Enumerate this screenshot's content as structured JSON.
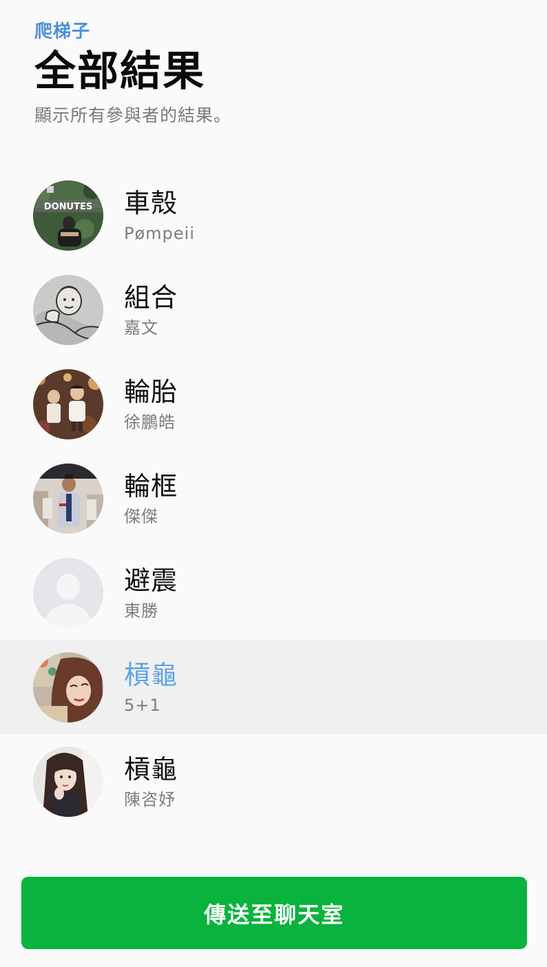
{
  "header": {
    "app_label": "爬梯子",
    "title": "全部結果",
    "subtitle": "顯示所有參與者的結果。"
  },
  "results": [
    {
      "name": "車殼",
      "user": "Pømpeii",
      "highlighted": false,
      "avatar": "photo-donutes-sign"
    },
    {
      "name": "組合",
      "user": "嘉文",
      "highlighted": false,
      "avatar": "cartoon-sketch"
    },
    {
      "name": "輪胎",
      "user": "徐鵬皓",
      "highlighted": false,
      "avatar": "photo-two-children"
    },
    {
      "name": "輪框",
      "user": "傑傑",
      "highlighted": false,
      "avatar": "photo-man-uniform"
    },
    {
      "name": "避震",
      "user": "東勝",
      "highlighted": false,
      "avatar": "default-avatar"
    },
    {
      "name": "槓龜",
      "user": "5+1",
      "highlighted": true,
      "avatar": "photo-woman-selfie"
    },
    {
      "name": "槓龜",
      "user": "陳咨妤",
      "highlighted": false,
      "avatar": "photo-woman-long-hair"
    }
  ],
  "send_button": {
    "label": "傳送至聊天室"
  },
  "colors": {
    "accent_blue": "#5ba4e6",
    "button_green": "#0ab33e",
    "highlight_row": "#f0f0f0"
  }
}
